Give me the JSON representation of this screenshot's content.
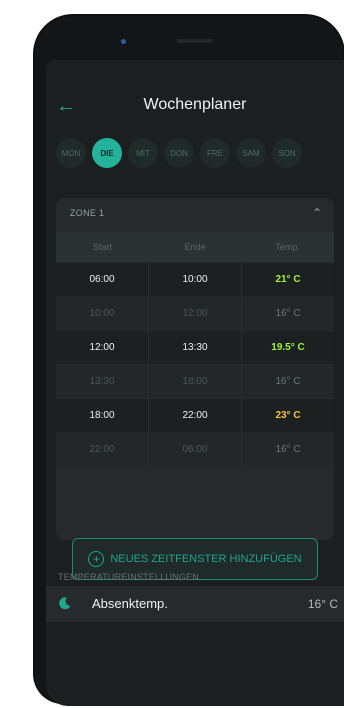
{
  "header": {
    "title": "Wochenplaner"
  },
  "days": [
    {
      "label": "MON",
      "active": false
    },
    {
      "label": "DIE",
      "active": true
    },
    {
      "label": "MIT",
      "active": false
    },
    {
      "label": "DON",
      "active": false
    },
    {
      "label": "FRE",
      "active": false
    },
    {
      "label": "SAM",
      "active": false
    },
    {
      "label": "SON",
      "active": false
    }
  ],
  "zone": {
    "label": "ZONE 1"
  },
  "table": {
    "headers": [
      "Start",
      "Ende",
      "Temp."
    ],
    "rows": [
      {
        "start": "06:00",
        "end": "10:00",
        "temp": "21° C",
        "dim": false,
        "color": "#9ff43f"
      },
      {
        "start": "10:00",
        "end": "12:00",
        "temp": "16° C",
        "dim": true,
        "color": ""
      },
      {
        "start": "12:00",
        "end": "13:30",
        "temp": "19.5° C",
        "dim": false,
        "color": "#9ff43f"
      },
      {
        "start": "13:30",
        "end": "18:00",
        "temp": "16° C",
        "dim": true,
        "color": ""
      },
      {
        "start": "18:00",
        "end": "22:00",
        "temp": "23° C",
        "dim": false,
        "color": "#f5c343"
      },
      {
        "start": "22:00",
        "end": "06:00",
        "temp": "16° C",
        "dim": true,
        "color": ""
      }
    ]
  },
  "add_button": {
    "label": "NEUES ZEITFENSTER HINZUFÜGEN"
  },
  "settings": {
    "section_label": "TEMPERATUREINSTELLUNGEN",
    "items": [
      {
        "icon": "moon-icon",
        "label": "Absenktemp.",
        "value": "16° C"
      }
    ]
  },
  "colors": {
    "accent": "#1fa68f",
    "active_day": "#22b39a",
    "warm": "#f5c343",
    "green": "#9ff43f"
  }
}
